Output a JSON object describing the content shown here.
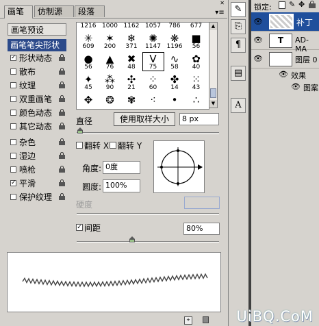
{
  "tabs": [
    "画笔",
    "仿制源",
    "段落"
  ],
  "window_controls": "◂◂ ✕",
  "panel_menu_icon": "menu-icon",
  "left_list": {
    "header": "画笔预设",
    "items": [
      {
        "label": "画笔笔尖形状",
        "checkbox": false,
        "selected": true,
        "lock": false
      },
      {
        "label": "形状动态",
        "checkbox": true,
        "checked": true,
        "lock": true
      },
      {
        "label": "散布",
        "checkbox": true,
        "checked": false,
        "lock": true
      },
      {
        "label": "纹理",
        "checkbox": true,
        "checked": false,
        "lock": true
      },
      {
        "label": "双重画笔",
        "checkbox": true,
        "checked": false,
        "lock": true
      },
      {
        "label": "颜色动态",
        "checkbox": true,
        "checked": false,
        "lock": true
      },
      {
        "label": "其它动态",
        "checkbox": true,
        "checked": false,
        "lock": true
      },
      {
        "label": "杂色",
        "checkbox": true,
        "checked": false,
        "lock": true
      },
      {
        "label": "湿边",
        "checkbox": true,
        "checked": false,
        "lock": true
      },
      {
        "label": "喷枪",
        "checkbox": true,
        "checked": false,
        "lock": true
      },
      {
        "label": "平滑",
        "checkbox": true,
        "checked": true,
        "lock": true
      },
      {
        "label": "保护纹理",
        "checkbox": true,
        "checked": false,
        "lock": true
      }
    ]
  },
  "brush_grid": {
    "rows": [
      [
        {
          "g": "",
          "n": "1216"
        },
        {
          "g": "",
          "n": "1000"
        },
        {
          "g": "",
          "n": "1162"
        },
        {
          "g": "",
          "n": "1057"
        },
        {
          "g": "",
          "n": "786"
        },
        {
          "g": "",
          "n": "677"
        }
      ],
      [
        {
          "g": "✳",
          "n": "609"
        },
        {
          "g": "✶",
          "n": "200"
        },
        {
          "g": "❄",
          "n": "371"
        },
        {
          "g": "✺",
          "n": "1147"
        },
        {
          "g": "❋",
          "n": "1196"
        },
        {
          "g": "■",
          "n": "56"
        }
      ],
      [
        {
          "g": "●",
          "n": "56"
        },
        {
          "g": "▲",
          "n": "76"
        },
        {
          "g": "✖",
          "n": "48"
        },
        {
          "g": "V",
          "n": "75"
        },
        {
          "g": "∿",
          "n": "58"
        },
        {
          "g": "✿",
          "n": "40"
        }
      ],
      [
        {
          "g": "✦",
          "n": "45"
        },
        {
          "g": "⁂",
          "n": "90"
        },
        {
          "g": "✣",
          "n": "21"
        },
        {
          "g": "⁘",
          "n": "60"
        },
        {
          "g": "✤",
          "n": "14"
        },
        {
          "g": "⁙",
          "n": "43"
        }
      ],
      [
        {
          "g": "✥",
          "n": ""
        },
        {
          "g": "❂",
          "n": ""
        },
        {
          "g": "✾",
          "n": ""
        },
        {
          "g": "⁖",
          "n": ""
        },
        {
          "g": "•",
          "n": ""
        },
        {
          "g": "∴",
          "n": ""
        }
      ]
    ],
    "selected_index": "75"
  },
  "controls": {
    "diameter_label": "直径",
    "use_sample_size_button": "使用取样大小",
    "diameter_value": "8 px",
    "flip_x_label": "翻转 X",
    "flip_y_label": "翻转 Y",
    "angle_label": "角度:",
    "angle_value": "0度",
    "roundness_label": "圆度:",
    "roundness_value": "100%",
    "hardness_label": "硬度",
    "spacing_label": "间距",
    "spacing_checked": true,
    "spacing_value": "80%"
  },
  "right_toolbar": [
    "brush-tool-icon",
    "clone-source-icon",
    "paragraph-icon",
    "layer-comps-icon",
    "character-icon"
  ],
  "layers": {
    "lock_label": "锁定:",
    "rows": [
      {
        "name": "补丁",
        "type": "pattern",
        "selected": true
      },
      {
        "name": "AD-MA",
        "type": "text",
        "selected": false
      },
      {
        "name": "图层 0",
        "type": "white",
        "selected": false
      },
      {
        "name": "效果",
        "type": "effect",
        "selected": false
      },
      {
        "name": "图案",
        "type": "effect-item",
        "selected": false
      }
    ]
  },
  "colors": {
    "selection": "#2c4a8a",
    "layer_selected": "#1f4f9c",
    "panel_bg": "#d6d3ce"
  },
  "watermark": "UiBQ.CoM"
}
